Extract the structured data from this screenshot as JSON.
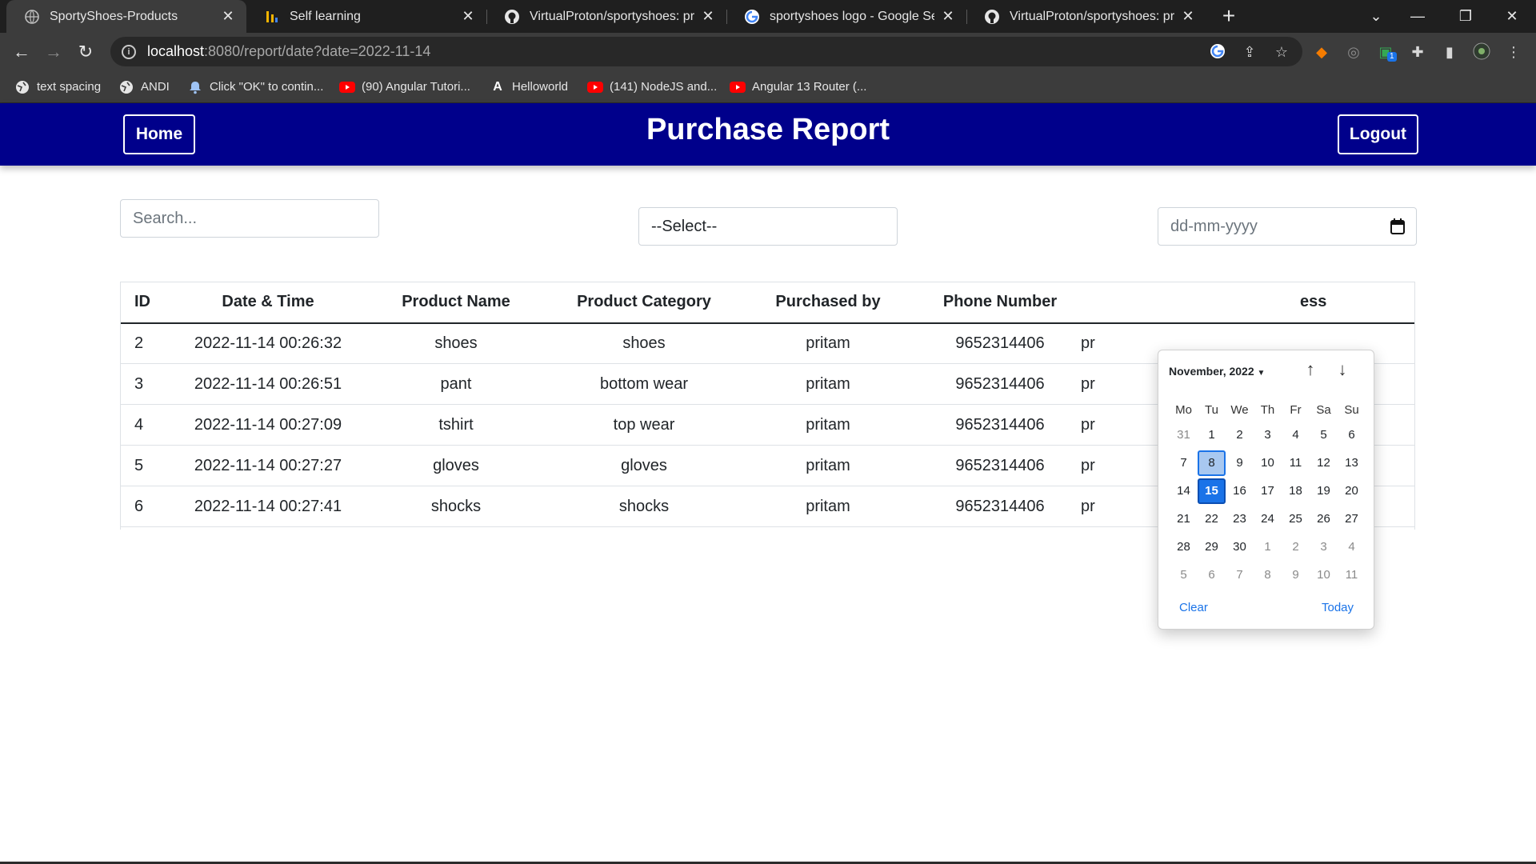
{
  "browser": {
    "tabs": [
      {
        "title": "SportyShoes-Products",
        "icon": "globe-icon",
        "active": true
      },
      {
        "title": "Self learning",
        "icon": "bar-chart-icon",
        "active": false
      },
      {
        "title": "VirtualProton/sportyshoes: proto",
        "icon": "github-icon",
        "active": false
      },
      {
        "title": "sportyshoes logo - Google Search",
        "icon": "google-icon",
        "active": false
      },
      {
        "title": "VirtualProton/sportyshoes: proto",
        "icon": "github-icon",
        "active": false
      }
    ],
    "url_host": "localhost",
    "url_path": ":8080/report/date?date=2022-11-14",
    "bookmarks": [
      {
        "label": "text spacing",
        "icon": "globe-icon"
      },
      {
        "label": "ANDI",
        "icon": "globe-icon"
      },
      {
        "label": "Click \"OK\" to contin...",
        "icon": "bell-icon"
      },
      {
        "label": "(90) Angular Tutori...",
        "icon": "youtube-icon"
      },
      {
        "label": "Helloworld",
        "icon": "angular-icon"
      },
      {
        "label": "(141) NodeJS and...",
        "icon": "youtube-icon"
      },
      {
        "label": "Angular 13 Router (...",
        "icon": "youtube-icon"
      }
    ],
    "extension_badge": "1"
  },
  "header": {
    "home_label": "Home",
    "title": "Purchase Report",
    "logout_label": "Logout",
    "bg_color": "#00008b"
  },
  "filters": {
    "search_placeholder": "Search...",
    "category_selected": "--Select--",
    "date_placeholder": "dd-mm-yyyy"
  },
  "table": {
    "columns": [
      "ID",
      "Date & Time",
      "Product Name",
      "Product Category",
      "Purchased by",
      "Phone Number",
      "",
      "ess"
    ],
    "rows": [
      {
        "id": "2",
        "datetime": "2022-11-14 00:26:32",
        "product": "shoes",
        "category": "shoes",
        "buyer": "pritam",
        "phone": "9652314406",
        "partial": "pr"
      },
      {
        "id": "3",
        "datetime": "2022-11-14 00:26:51",
        "product": "pant",
        "category": "bottom wear",
        "buyer": "pritam",
        "phone": "9652314406",
        "partial": "pr"
      },
      {
        "id": "4",
        "datetime": "2022-11-14 00:27:09",
        "product": "tshirt",
        "category": "top wear",
        "buyer": "pritam",
        "phone": "9652314406",
        "partial": "pr"
      },
      {
        "id": "5",
        "datetime": "2022-11-14 00:27:27",
        "product": "gloves",
        "category": "gloves",
        "buyer": "pritam",
        "phone": "9652314406",
        "partial": "pr"
      },
      {
        "id": "6",
        "datetime": "2022-11-14 00:27:41",
        "product": "shocks",
        "category": "shocks",
        "buyer": "pritam",
        "phone": "9652314406",
        "partial": "pr"
      }
    ]
  },
  "datepicker": {
    "month_label": "November, 2022",
    "weekdays": [
      "Mo",
      "Tu",
      "We",
      "Th",
      "Fr",
      "Sa",
      "Su"
    ],
    "weeks": [
      [
        [
          "31",
          "muted"
        ],
        [
          "1",
          ""
        ],
        [
          "2",
          ""
        ],
        [
          "3",
          ""
        ],
        [
          "4",
          ""
        ],
        [
          "5",
          ""
        ],
        [
          "6",
          ""
        ]
      ],
      [
        [
          "7",
          ""
        ],
        [
          "8",
          "sel"
        ],
        [
          "9",
          ""
        ],
        [
          "10",
          ""
        ],
        [
          "11",
          ""
        ],
        [
          "12",
          ""
        ],
        [
          "13",
          ""
        ]
      ],
      [
        [
          "14",
          ""
        ],
        [
          "15",
          "today"
        ],
        [
          "16",
          ""
        ],
        [
          "17",
          ""
        ],
        [
          "18",
          ""
        ],
        [
          "19",
          ""
        ],
        [
          "20",
          ""
        ]
      ],
      [
        [
          "21",
          ""
        ],
        [
          "22",
          ""
        ],
        [
          "23",
          ""
        ],
        [
          "24",
          ""
        ],
        [
          "25",
          ""
        ],
        [
          "26",
          ""
        ],
        [
          "27",
          ""
        ]
      ],
      [
        [
          "28",
          ""
        ],
        [
          "29",
          ""
        ],
        [
          "30",
          ""
        ],
        [
          "1",
          "muted"
        ],
        [
          "2",
          "muted"
        ],
        [
          "3",
          "muted"
        ],
        [
          "4",
          "muted"
        ]
      ],
      [
        [
          "5",
          "muted"
        ],
        [
          "6",
          "muted"
        ],
        [
          "7",
          "muted"
        ],
        [
          "8",
          "muted"
        ],
        [
          "9",
          "muted"
        ],
        [
          "10",
          "muted"
        ],
        [
          "11",
          "muted"
        ]
      ]
    ],
    "clear_label": "Clear",
    "today_label": "Today",
    "accent_color": "#1a73e8"
  }
}
